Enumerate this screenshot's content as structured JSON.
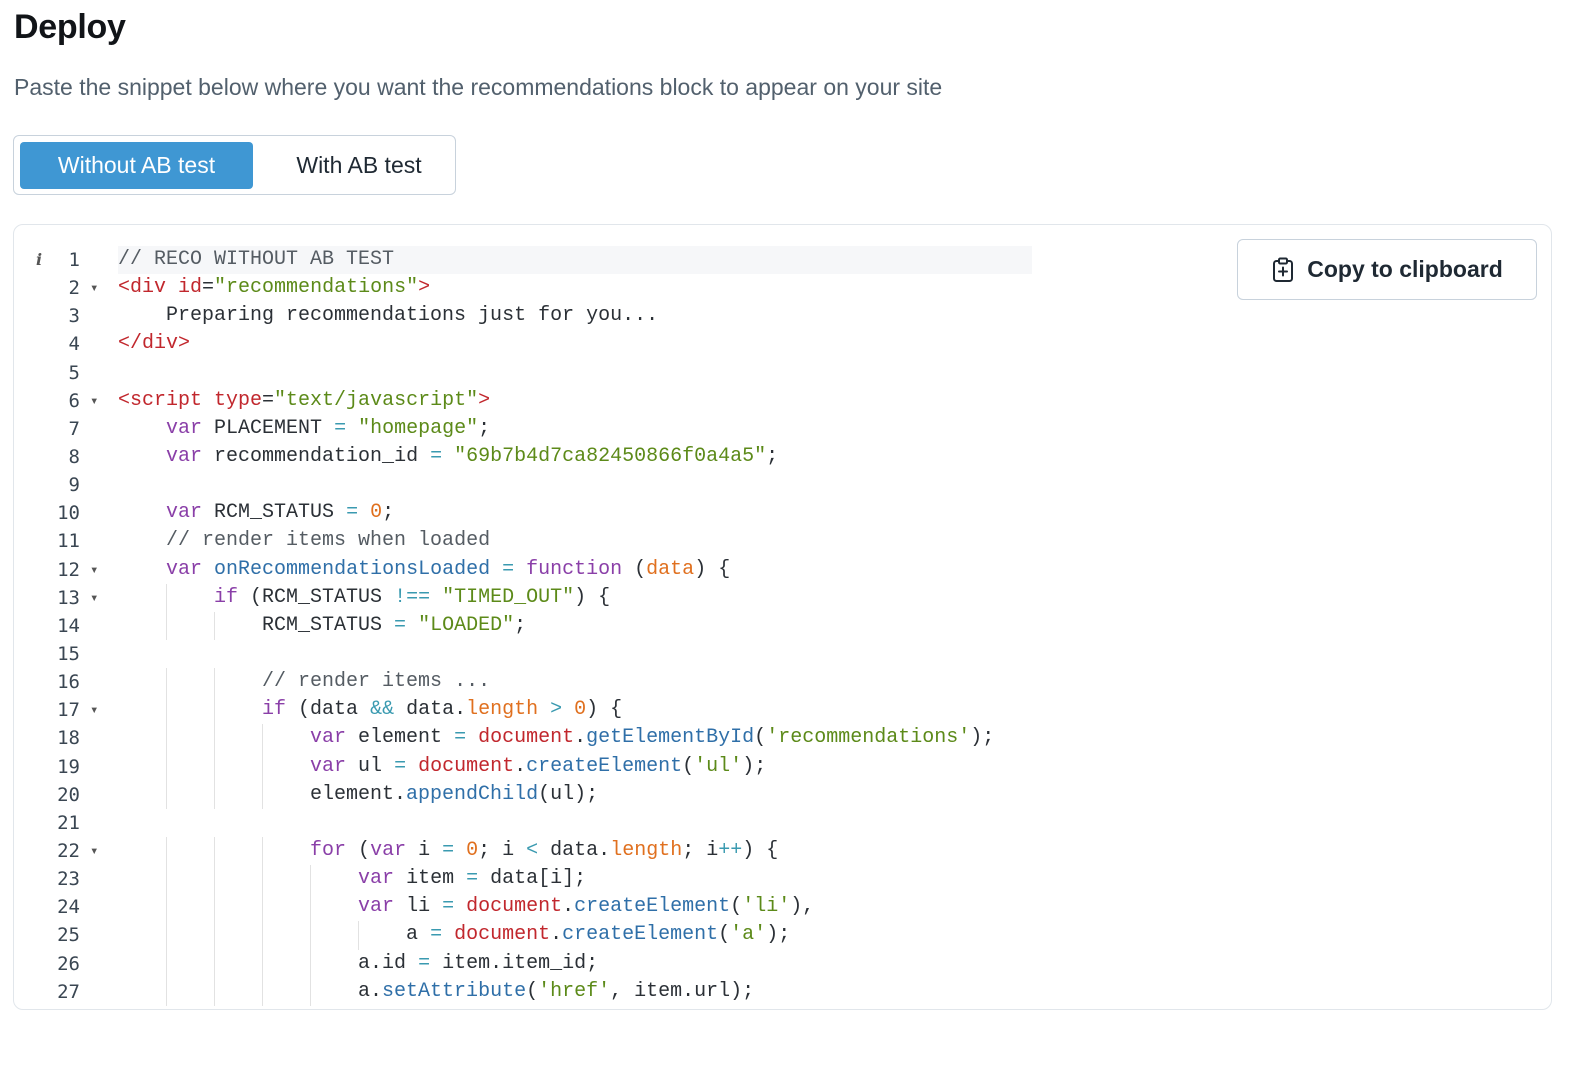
{
  "header": {
    "title": "Deploy",
    "subtitle": "Paste the snippet below where you want the recommendations block to appear on your site"
  },
  "toggle": {
    "options": [
      {
        "label": "Without AB test",
        "active": true
      },
      {
        "label": "With AB test",
        "active": false
      }
    ]
  },
  "copy_button": {
    "label": "Copy to clipboard",
    "icon": "clipboard-icon"
  },
  "editor": {
    "info_icon": "i",
    "colors": {
      "comment": "#555c63",
      "tag": "#c1272d",
      "attr": "#c1272d",
      "string": "#5c8a19",
      "keyword": "#8a3fa8",
      "number": "#e0701f",
      "func_name": "#2f6fa8",
      "property": "#e0701f",
      "builtin": "#c1272d",
      "method": "#2f6fa8",
      "operator": "#3a9ab0",
      "plain": "#2b3036"
    },
    "lines": [
      {
        "n": "1",
        "fold": false,
        "guides": 0,
        "tokens": [
          {
            "t": "// RECO WITHOUT AB TEST",
            "c": "comment"
          }
        ]
      },
      {
        "n": "2",
        "fold": true,
        "guides": 0,
        "tokens": [
          {
            "t": "<div ",
            "c": "tag"
          },
          {
            "t": "id",
            "c": "attr"
          },
          {
            "t": "=",
            "c": "plain"
          },
          {
            "t": "\"recommendations\"",
            "c": "string"
          },
          {
            "t": ">",
            "c": "tag"
          }
        ]
      },
      {
        "n": "3",
        "fold": false,
        "guides": 0,
        "tokens": [
          {
            "t": "    Preparing recommendations just for you...",
            "c": "plain"
          }
        ]
      },
      {
        "n": "4",
        "fold": false,
        "guides": 0,
        "tokens": [
          {
            "t": "</div>",
            "c": "tag"
          }
        ]
      },
      {
        "n": "5",
        "fold": false,
        "guides": 0,
        "tokens": []
      },
      {
        "n": "6",
        "fold": true,
        "guides": 0,
        "tokens": [
          {
            "t": "<script ",
            "c": "tag"
          },
          {
            "t": "type",
            "c": "attr"
          },
          {
            "t": "=",
            "c": "plain"
          },
          {
            "t": "\"text/javascript\"",
            "c": "string"
          },
          {
            "t": ">",
            "c": "tag"
          }
        ]
      },
      {
        "n": "7",
        "fold": false,
        "guides": 0,
        "tokens": [
          {
            "t": "    ",
            "c": "plain"
          },
          {
            "t": "var",
            "c": "keyword"
          },
          {
            "t": " PLACEMENT ",
            "c": "plain"
          },
          {
            "t": "=",
            "c": "operator"
          },
          {
            "t": " ",
            "c": "plain"
          },
          {
            "t": "\"homepage\"",
            "c": "string"
          },
          {
            "t": ";",
            "c": "plain"
          }
        ]
      },
      {
        "n": "8",
        "fold": false,
        "guides": 0,
        "tokens": [
          {
            "t": "    ",
            "c": "plain"
          },
          {
            "t": "var",
            "c": "keyword"
          },
          {
            "t": " recommendation_id ",
            "c": "plain"
          },
          {
            "t": "=",
            "c": "operator"
          },
          {
            "t": " ",
            "c": "plain"
          },
          {
            "t": "\"69b7b4d7ca82450866f0a4a5\"",
            "c": "string"
          },
          {
            "t": ";",
            "c": "plain"
          }
        ]
      },
      {
        "n": "9",
        "fold": false,
        "guides": 0,
        "tokens": []
      },
      {
        "n": "10",
        "fold": false,
        "guides": 0,
        "tokens": [
          {
            "t": "    ",
            "c": "plain"
          },
          {
            "t": "var",
            "c": "keyword"
          },
          {
            "t": " RCM_STATUS ",
            "c": "plain"
          },
          {
            "t": "=",
            "c": "operator"
          },
          {
            "t": " ",
            "c": "plain"
          },
          {
            "t": "0",
            "c": "number"
          },
          {
            "t": ";",
            "c": "plain"
          }
        ]
      },
      {
        "n": "11",
        "fold": false,
        "guides": 0,
        "tokens": [
          {
            "t": "    ",
            "c": "plain"
          },
          {
            "t": "// render items when loaded",
            "c": "comment"
          }
        ]
      },
      {
        "n": "12",
        "fold": true,
        "guides": 0,
        "tokens": [
          {
            "t": "    ",
            "c": "plain"
          },
          {
            "t": "var",
            "c": "keyword"
          },
          {
            "t": " ",
            "c": "plain"
          },
          {
            "t": "onRecommendationsLoaded",
            "c": "func_name"
          },
          {
            "t": " ",
            "c": "plain"
          },
          {
            "t": "=",
            "c": "operator"
          },
          {
            "t": " ",
            "c": "plain"
          },
          {
            "t": "function",
            "c": "keyword"
          },
          {
            "t": " (",
            "c": "plain"
          },
          {
            "t": "data",
            "c": "number"
          },
          {
            "t": ") {",
            "c": "plain"
          }
        ]
      },
      {
        "n": "13",
        "fold": true,
        "guides": 1,
        "tokens": [
          {
            "t": "        ",
            "c": "plain"
          },
          {
            "t": "if",
            "c": "keyword"
          },
          {
            "t": " (RCM_STATUS ",
            "c": "plain"
          },
          {
            "t": "!==",
            "c": "operator"
          },
          {
            "t": " ",
            "c": "plain"
          },
          {
            "t": "\"TIMED_OUT\"",
            "c": "string"
          },
          {
            "t": ") {",
            "c": "plain"
          }
        ]
      },
      {
        "n": "14",
        "fold": false,
        "guides": 2,
        "tokens": [
          {
            "t": "            RCM_STATUS ",
            "c": "plain"
          },
          {
            "t": "=",
            "c": "operator"
          },
          {
            "t": " ",
            "c": "plain"
          },
          {
            "t": "\"LOADED\"",
            "c": "string"
          },
          {
            "t": ";",
            "c": "plain"
          }
        ]
      },
      {
        "n": "15",
        "fold": false,
        "guides": 0,
        "tokens": []
      },
      {
        "n": "16",
        "fold": false,
        "guides": 2,
        "tokens": [
          {
            "t": "            ",
            "c": "plain"
          },
          {
            "t": "// render items ...",
            "c": "comment"
          }
        ]
      },
      {
        "n": "17",
        "fold": true,
        "guides": 2,
        "tokens": [
          {
            "t": "            ",
            "c": "plain"
          },
          {
            "t": "if",
            "c": "keyword"
          },
          {
            "t": " (data ",
            "c": "plain"
          },
          {
            "t": "&&",
            "c": "operator"
          },
          {
            "t": " data.",
            "c": "plain"
          },
          {
            "t": "length",
            "c": "property"
          },
          {
            "t": " ",
            "c": "plain"
          },
          {
            "t": ">",
            "c": "operator"
          },
          {
            "t": " ",
            "c": "plain"
          },
          {
            "t": "0",
            "c": "number"
          },
          {
            "t": ") {",
            "c": "plain"
          }
        ]
      },
      {
        "n": "18",
        "fold": false,
        "guides": 3,
        "tokens": [
          {
            "t": "                ",
            "c": "plain"
          },
          {
            "t": "var",
            "c": "keyword"
          },
          {
            "t": " element ",
            "c": "plain"
          },
          {
            "t": "=",
            "c": "operator"
          },
          {
            "t": " ",
            "c": "plain"
          },
          {
            "t": "document",
            "c": "builtin"
          },
          {
            "t": ".",
            "c": "plain"
          },
          {
            "t": "getElementById",
            "c": "method"
          },
          {
            "t": "(",
            "c": "plain"
          },
          {
            "t": "'recommendations'",
            "c": "string"
          },
          {
            "t": ");",
            "c": "plain"
          }
        ]
      },
      {
        "n": "19",
        "fold": false,
        "guides": 3,
        "tokens": [
          {
            "t": "                ",
            "c": "plain"
          },
          {
            "t": "var",
            "c": "keyword"
          },
          {
            "t": " ul ",
            "c": "plain"
          },
          {
            "t": "=",
            "c": "operator"
          },
          {
            "t": " ",
            "c": "plain"
          },
          {
            "t": "document",
            "c": "builtin"
          },
          {
            "t": ".",
            "c": "plain"
          },
          {
            "t": "createElement",
            "c": "method"
          },
          {
            "t": "(",
            "c": "plain"
          },
          {
            "t": "'ul'",
            "c": "string"
          },
          {
            "t": ");",
            "c": "plain"
          }
        ]
      },
      {
        "n": "20",
        "fold": false,
        "guides": 3,
        "tokens": [
          {
            "t": "                element.",
            "c": "plain"
          },
          {
            "t": "appendChild",
            "c": "method"
          },
          {
            "t": "(ul);",
            "c": "plain"
          }
        ]
      },
      {
        "n": "21",
        "fold": false,
        "guides": 0,
        "tokens": []
      },
      {
        "n": "22",
        "fold": true,
        "guides": 3,
        "tokens": [
          {
            "t": "                ",
            "c": "plain"
          },
          {
            "t": "for",
            "c": "keyword"
          },
          {
            "t": " (",
            "c": "plain"
          },
          {
            "t": "var",
            "c": "keyword"
          },
          {
            "t": " i ",
            "c": "plain"
          },
          {
            "t": "=",
            "c": "operator"
          },
          {
            "t": " ",
            "c": "plain"
          },
          {
            "t": "0",
            "c": "number"
          },
          {
            "t": "; i ",
            "c": "plain"
          },
          {
            "t": "<",
            "c": "operator"
          },
          {
            "t": " data.",
            "c": "plain"
          },
          {
            "t": "length",
            "c": "property"
          },
          {
            "t": "; i",
            "c": "plain"
          },
          {
            "t": "++",
            "c": "operator"
          },
          {
            "t": ") {",
            "c": "plain"
          }
        ]
      },
      {
        "n": "23",
        "fold": false,
        "guides": 4,
        "tokens": [
          {
            "t": "                    ",
            "c": "plain"
          },
          {
            "t": "var",
            "c": "keyword"
          },
          {
            "t": " item ",
            "c": "plain"
          },
          {
            "t": "=",
            "c": "operator"
          },
          {
            "t": " data[i];",
            "c": "plain"
          }
        ]
      },
      {
        "n": "24",
        "fold": false,
        "guides": 4,
        "tokens": [
          {
            "t": "                    ",
            "c": "plain"
          },
          {
            "t": "var",
            "c": "keyword"
          },
          {
            "t": " li ",
            "c": "plain"
          },
          {
            "t": "=",
            "c": "operator"
          },
          {
            "t": " ",
            "c": "plain"
          },
          {
            "t": "document",
            "c": "builtin"
          },
          {
            "t": ".",
            "c": "plain"
          },
          {
            "t": "createElement",
            "c": "method"
          },
          {
            "t": "(",
            "c": "plain"
          },
          {
            "t": "'li'",
            "c": "string"
          },
          {
            "t": "),",
            "c": "plain"
          }
        ]
      },
      {
        "n": "25",
        "fold": false,
        "guides": 5,
        "tokens": [
          {
            "t": "                        a ",
            "c": "plain"
          },
          {
            "t": "=",
            "c": "operator"
          },
          {
            "t": " ",
            "c": "plain"
          },
          {
            "t": "document",
            "c": "builtin"
          },
          {
            "t": ".",
            "c": "plain"
          },
          {
            "t": "createElement",
            "c": "method"
          },
          {
            "t": "(",
            "c": "plain"
          },
          {
            "t": "'a'",
            "c": "string"
          },
          {
            "t": ");",
            "c": "plain"
          }
        ]
      },
      {
        "n": "26",
        "fold": false,
        "guides": 4,
        "tokens": [
          {
            "t": "                    a.id ",
            "c": "plain"
          },
          {
            "t": "=",
            "c": "operator"
          },
          {
            "t": " item.item_id;",
            "c": "plain"
          }
        ]
      },
      {
        "n": "27",
        "fold": false,
        "guides": 4,
        "tokens": [
          {
            "t": "                    a.",
            "c": "plain"
          },
          {
            "t": "setAttribute",
            "c": "method"
          },
          {
            "t": "(",
            "c": "plain"
          },
          {
            "t": "'href'",
            "c": "string"
          },
          {
            "t": ", item.url);",
            "c": "plain"
          }
        ]
      }
    ]
  }
}
